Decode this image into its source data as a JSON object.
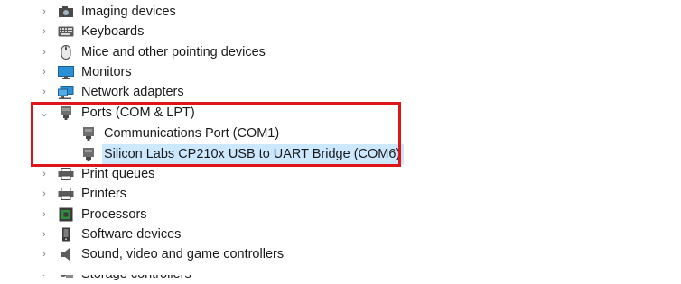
{
  "tree": {
    "items": [
      {
        "label": "Imaging devices",
        "icon": "imaging-devices-icon",
        "state": "collapsed"
      },
      {
        "label": "Keyboards",
        "icon": "keyboard-icon",
        "state": "collapsed"
      },
      {
        "label": "Mice and other pointing devices",
        "icon": "mouse-icon",
        "state": "collapsed"
      },
      {
        "label": "Monitors",
        "icon": "monitor-icon",
        "state": "collapsed"
      },
      {
        "label": "Network adapters",
        "icon": "network-adapter-icon",
        "state": "collapsed"
      },
      {
        "label": "Ports (COM & LPT)",
        "icon": "port-icon",
        "state": "expanded",
        "children": [
          {
            "label": "Communications Port (COM1)",
            "icon": "port-icon"
          },
          {
            "label": "Silicon Labs CP210x USB to UART Bridge (COM6)",
            "icon": "port-icon",
            "selected": true
          }
        ]
      },
      {
        "label": "Print queues",
        "icon": "print-queue-icon",
        "state": "collapsed"
      },
      {
        "label": "Printers",
        "icon": "printer-icon",
        "state": "collapsed"
      },
      {
        "label": "Processors",
        "icon": "processor-icon",
        "state": "collapsed"
      },
      {
        "label": "Software devices",
        "icon": "software-device-icon",
        "state": "collapsed"
      },
      {
        "label": "Sound, video and game controllers",
        "icon": "speaker-icon",
        "state": "collapsed"
      },
      {
        "label": "Storage controllers",
        "icon": "storage-controller-icon",
        "state": "collapsed"
      }
    ]
  },
  "colors": {
    "highlight_border": "#e0151c",
    "selection_bg": "#cce8ff"
  }
}
